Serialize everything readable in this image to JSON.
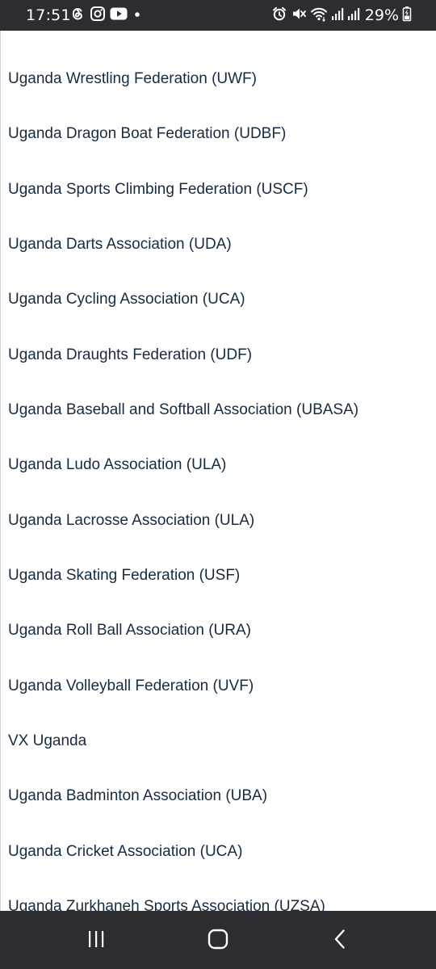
{
  "status_bar": {
    "time": "17:51",
    "battery": "29%",
    "left_icons": [
      "threads-icon",
      "instagram-icon",
      "youtube-icon",
      "dot-icon"
    ],
    "right_icons": [
      "alarm-icon",
      "mute-icon",
      "wifi-icon",
      "signal-icon",
      "signal-icon",
      "battery-icon"
    ]
  },
  "list": {
    "items": [
      "Uganda Wrestling Federation (UWF)",
      "Uganda Dragon Boat Federation (UDBF)",
      "Uganda Sports Climbing Federation (USCF)",
      "Uganda Darts Association (UDA)",
      "Uganda Cycling Association (UCA)",
      "Uganda Draughts Federation (UDF)",
      "Uganda Baseball and Softball Association (UBASA)",
      "Uganda Ludo Association (ULA)",
      "Uganda Lacrosse Association (ULA)",
      "Uganda Skating Federation (USF)",
      "Uganda Roll Ball Association (URA)",
      "Uganda Volleyball Federation (UVF)",
      "VX Uganda",
      "Uganda Badminton Association (UBA)",
      "Uganda Cricket Association (UCA)",
      "Uganda Zurkhaneh Sports Association (UZSA)"
    ]
  },
  "nav_bar": {
    "buttons": [
      "recent-apps-icon",
      "home-icon",
      "back-icon"
    ]
  },
  "colors": {
    "system_bar": "#2b2d30",
    "text": "#172b40",
    "background": "#ffffff"
  }
}
